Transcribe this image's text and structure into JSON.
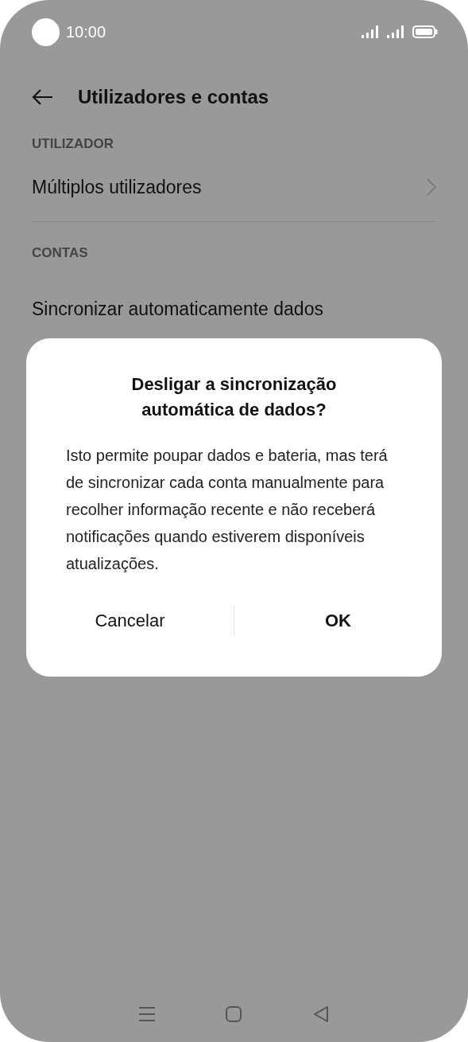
{
  "status_bar": {
    "time": "10:00"
  },
  "header": {
    "title": "Utilizadores e contas"
  },
  "sections": [
    {
      "heading": "UTILIZADOR",
      "items": [
        {
          "label": "Múltiplos utilizadores",
          "chevron": true
        }
      ]
    },
    {
      "heading": "CONTAS",
      "items": [
        {
          "label": "Sincronizar automaticamente dados",
          "chevron": false
        }
      ]
    }
  ],
  "dialog": {
    "title": "Desligar a sincronização automática de dados?",
    "message": "Isto permite poupar dados e bateria, mas terá de sincronizar cada conta manualmente para recolher informação recente e não receberá notificações quando estiverem disponíveis atualizações.",
    "buttons": [
      {
        "label": "Cancelar",
        "primary": false
      },
      {
        "label": "OK",
        "primary": true
      }
    ]
  }
}
